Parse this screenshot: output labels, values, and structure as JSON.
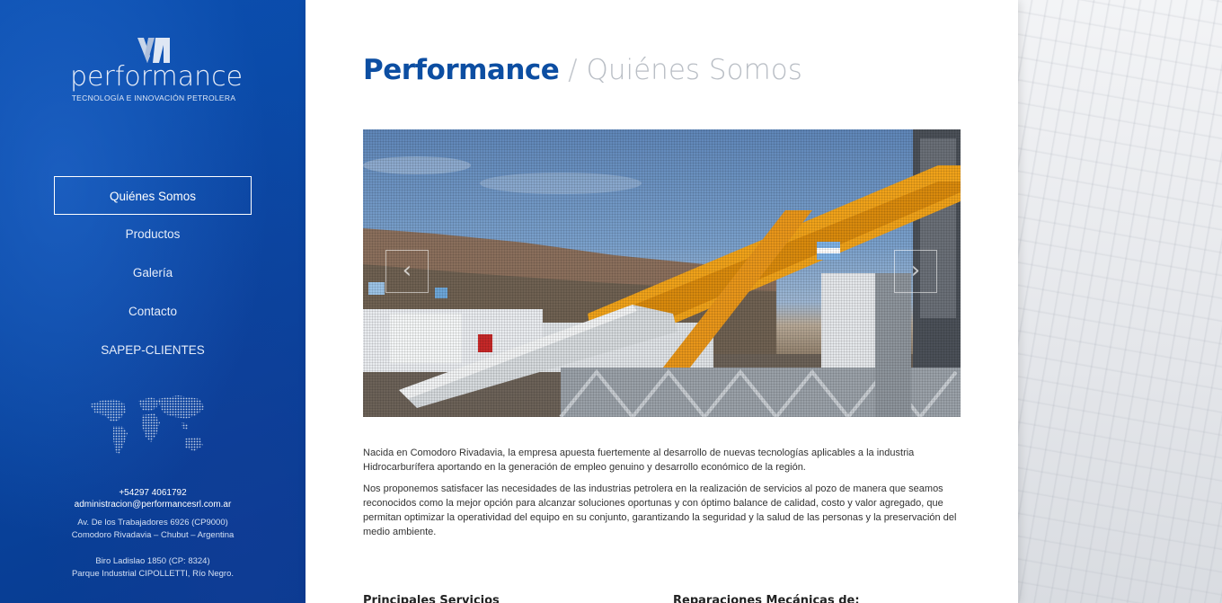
{
  "brand": {
    "name": "performance",
    "tagline": "TECNOLOGÍA E INNOVACIÓN PETROLERA",
    "primary_color": "#0b4fb0"
  },
  "nav": {
    "items": [
      {
        "label": "Quiénes Somos",
        "active": true
      },
      {
        "label": "Productos",
        "active": false
      },
      {
        "label": "Galería",
        "active": false
      },
      {
        "label": "Contacto",
        "active": false
      },
      {
        "label": "SAPEP-CLIENTES",
        "active": false
      }
    ]
  },
  "contact": {
    "phone": "+54297 4061792",
    "email": "administracion@performancesrl.com.ar",
    "address1_line1": "Av. De los Trabajadores 6926 (CP9000)",
    "address1_line2": "Comodoro Rivadavia – Chubut – Argentina",
    "address2_line1": "Biro Ladislao 1850 (CP: 8324)",
    "address2_line2": "Parque Industrial CIPOLLETTI, Río Negro."
  },
  "page": {
    "title_strong": "Performance",
    "title_sep": " / ",
    "title_light": "Quiénes Somos"
  },
  "slider": {
    "prev_icon": "chevron-left-icon",
    "next_icon": "chevron-right-icon",
    "prev_glyph": "‹",
    "next_glyph": "›"
  },
  "content": {
    "paragraph1": "Nacida en Comodoro Rivadavia, la empresa apuesta fuertemente al desarrollo de nuevas tecnologías aplicables a la industria Hidrocarburífera aportando en la generación de empleo genuino y desarrollo económico de la región.",
    "paragraph2": "Nos proponemos satisfacer las necesidades de las industrias petrolera en la realización de servicios al pozo de manera que seamos reconocidos como la mejor opción para alcanzar soluciones oportunas y con óptimo balance de calidad, costo y valor agregado, que permitan optimizar la operatividad del equipo en su conjunto, garantizando la seguridad y la salud de las personas y la preservación del medio ambiente.",
    "subheading1": "Principales Servicios",
    "subheading2": "Reparaciones Mecánicas de:"
  }
}
